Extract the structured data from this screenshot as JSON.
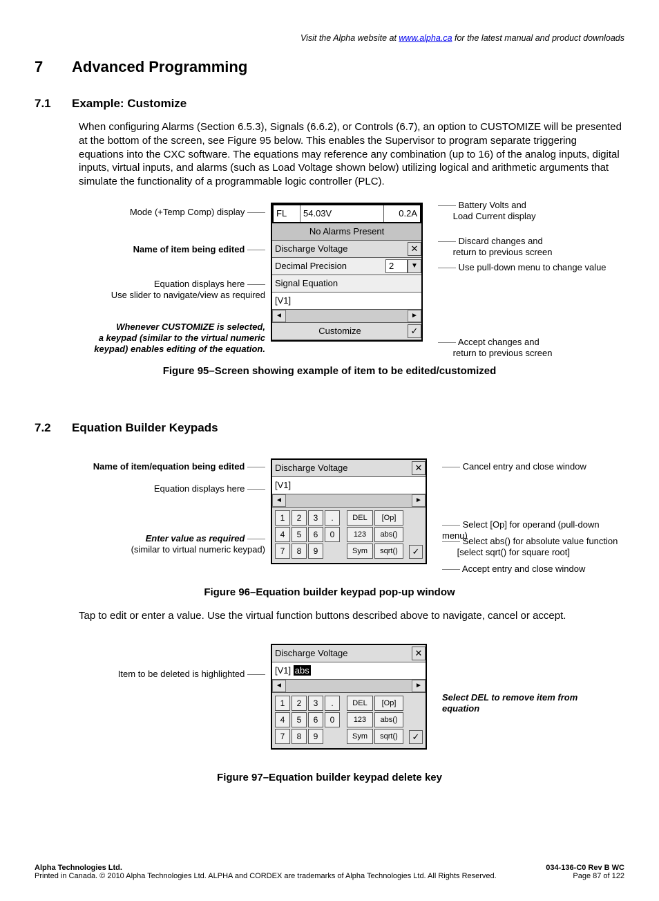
{
  "header": {
    "prefix": "Visit the Alpha website at ",
    "link_text": "www.alpha.ca",
    "suffix": " for the latest manual and product downloads"
  },
  "h1": {
    "num": "7",
    "title": "Advanced Programming"
  },
  "s71": {
    "num": "7.1",
    "title": "Example: Customize",
    "para": "When configuring Alarms (Section 6.5.3), Signals (6.6.2), or Controls (6.7), an option to CUSTOMIZE will be presented at the bottom of the screen, see Figure 95 below. This enables the Supervisor to program separate triggering equations into the CXC software. The equations may reference any combination (up to 16) of the analog inputs, digital inputs, virtual inputs, and alarms (such as Load Voltage shown below) utilizing logical and arithmetic arguments that simulate the functionality of a programmable logic controller (PLC)."
  },
  "fig95": {
    "left": {
      "a1": "Mode (+Temp Comp) display",
      "a2": "Name of item being edited",
      "a3a": "Equation displays here",
      "a3b": "Use slider to navigate/view as required",
      "a4a": "Whenever CUSTOMIZE is selected,",
      "a4b": "a keypad (similar to the virtual numeric",
      "a4c": "keypad) enables editing of the equation."
    },
    "screen": {
      "mode": "FL",
      "volts": "54.03V",
      "amps": "0.2A",
      "alarms": "No Alarms Present",
      "item_name": "Discharge Voltage",
      "precision_label": "Decimal Precision",
      "precision_value": "2",
      "sig_eq_label": "Signal Equation",
      "eq_value": "[V1]",
      "customize_btn": "Customize"
    },
    "right": {
      "r1a": "Battery Volts and",
      "r1b": "Load Current display",
      "r2a": "Discard changes and",
      "r2b": "return to previous screen",
      "r3": "Use pull-down menu to change value",
      "r4a": "Accept changes and",
      "r4b": "return to previous screen"
    },
    "caption": "Figure 95–Screen showing example of item to be edited/customized"
  },
  "s72": {
    "num": "7.2",
    "title": "Equation Builder Keypads"
  },
  "fig96": {
    "left": {
      "a1": "Name of item/equation being edited",
      "a2": "Equation displays here",
      "a3a": "Enter value as required",
      "a3b": "(similar to virtual numeric keypad)"
    },
    "screen": {
      "title": "Discharge Voltage",
      "eq": "[V1]",
      "keys": [
        "1",
        "2",
        "3",
        ".",
        "4",
        "5",
        "6",
        "0",
        "7",
        "8",
        "9",
        ""
      ],
      "fn": {
        "del": "DEL",
        "op": "[Op]",
        "n123": "123",
        "abs": "abs()",
        "sym": "Sym",
        "sqrt": "sqrt()"
      }
    },
    "right": {
      "r1": "Cancel entry and close window",
      "r2": "Select [Op] for operand (pull-down menu)",
      "r3a": "Select abs() for absolute value function",
      "r3b": "[select sqrt() for square root]",
      "r4": "Accept entry and close window"
    },
    "caption": "Figure 96–Equation builder keypad pop-up window",
    "after": "Tap to edit or enter a value. Use the virtual function buttons described above to navigate, cancel or accept."
  },
  "fig97": {
    "left": {
      "a1": "Item to be deleted is highlighted"
    },
    "screen": {
      "title": "Discharge Voltage",
      "eq_prefix": "[V1] ",
      "eq_hl": "abs"
    },
    "right": {
      "r1a": "Select DEL to remove item from",
      "r1b": "equation"
    },
    "caption": "Figure 97–Equation builder keypad delete key"
  },
  "footer": {
    "left1": "Alpha Technologies Ltd.",
    "left2": "Printed in Canada.  © 2010 Alpha Technologies Ltd.  ALPHA and CORDEX are trademarks of Alpha Technologies Ltd.  All Rights Reserved.",
    "right1": "034-136-C0  Rev B  WC",
    "right2": "Page 87 of 122"
  }
}
